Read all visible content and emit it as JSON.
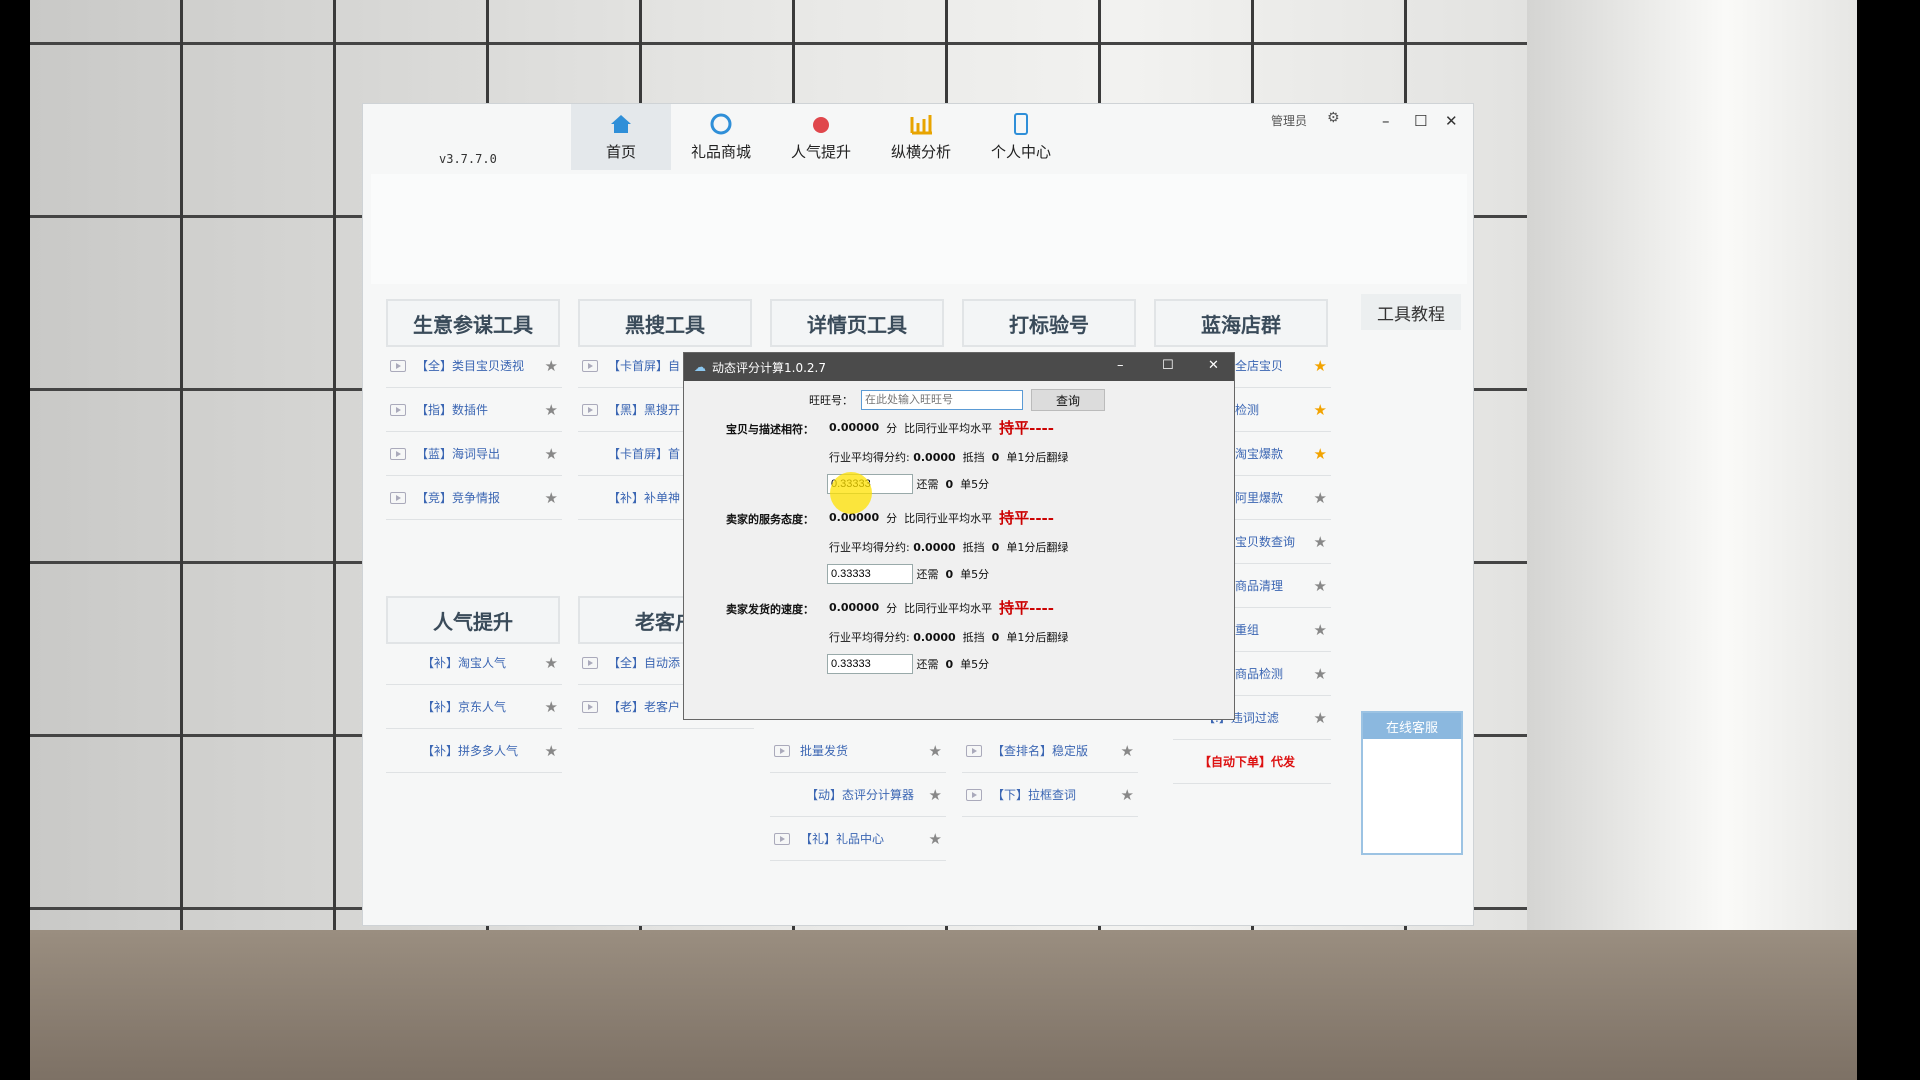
{
  "app": {
    "version": "v3.7.7.0",
    "nav": [
      {
        "label": "首页",
        "icon": "home-icon"
      },
      {
        "label": "礼品商城",
        "icon": "gift-icon"
      },
      {
        "label": "人气提升",
        "icon": "rocket-icon"
      },
      {
        "label": "纵横分析",
        "icon": "chart-icon"
      },
      {
        "label": "个人中心",
        "icon": "phone-icon"
      }
    ],
    "admin": "管理员",
    "colors": {
      "accent": "#3b66b3",
      "header_text": "#3a4b5a",
      "warn": "#cc0000",
      "star": "#f2a300"
    }
  },
  "sections": {
    "s1": {
      "title": "生意参谋工具",
      "items": [
        "【全】类目宝贝透视",
        "【指】数插件",
        "【蓝】海词导出",
        "【竞】竞争情报"
      ]
    },
    "s2": {
      "title": "黑搜工具",
      "items": [
        "【卡首屏】自",
        "【黑】黑搜开",
        "【卡首屏】首",
        "【补】补单神"
      ]
    },
    "s3": {
      "title": "详情页工具",
      "items": [
        "批量发货",
        "【动】态评分计算器",
        "【礼】礼品中心"
      ]
    },
    "s4": {
      "title": "打标验号",
      "items": [
        "【查排名】稳定版",
        "【下】拉框查词"
      ]
    },
    "s5": {
      "title": "蓝海店群",
      "items": [
        "全店宝贝",
        "检测",
        "淘宝爆款",
        "阿里爆款",
        "宝贝数查询",
        "商品清理",
        "重组",
        "商品检测",
        "【.】违词过滤",
        "【自动下单】代发"
      ]
    },
    "s6": {
      "title": "人气提升",
      "items": [
        "【补】淘宝人气",
        "【补】京东人气",
        "【补】拼多多人气"
      ]
    },
    "s7": {
      "title": "老客户",
      "items": [
        "【全】自动添",
        "【老】老客户"
      ]
    }
  },
  "side": {
    "tutorial": "工具教程",
    "service": "在线客服"
  },
  "dialog": {
    "title": "动态评分计算1.0.2.7",
    "wangwang_label": "旺旺号：",
    "wangwang_placeholder": "在此处输入旺旺号",
    "query": "查询",
    "rows": [
      {
        "label": "宝贝与描述相符：",
        "score": "0.00000",
        "unit": "分",
        "cmp": "比同行业平均水平",
        "status": "持平----",
        "avg_label": "行业平均得分约:",
        "avg": "0.0000",
        "offset_label": "抵挡",
        "offset": "0",
        "after": "单1分后翻绿",
        "input": "0.33333",
        "need": "还需",
        "need_val": "0",
        "five": "单5分"
      },
      {
        "label": "卖家的服务态度：",
        "score": "0.00000",
        "unit": "分",
        "cmp": "比同行业平均水平",
        "status": "持平----",
        "avg_label": "行业平均得分约:",
        "avg": "0.0000",
        "offset_label": "抵挡",
        "offset": "0",
        "after": "单1分后翻绿",
        "input": "0.33333",
        "need": "还需",
        "need_val": "0",
        "five": "单5分"
      },
      {
        "label": "卖家发货的速度：",
        "score": "0.00000",
        "unit": "分",
        "cmp": "比同行业平均水平",
        "status": "持平----",
        "avg_label": "行业平均得分约:",
        "avg": "0.0000",
        "offset_label": "抵挡",
        "offset": "0",
        "after": "单1分后翻绿",
        "input": "0.33333",
        "need": "还需",
        "need_val": "0",
        "five": "单5分"
      }
    ]
  }
}
